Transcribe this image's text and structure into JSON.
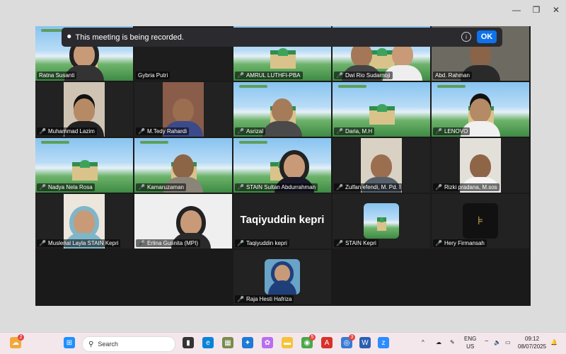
{
  "window_controls": {
    "minimize": "—",
    "restore": "❐",
    "close": "✕"
  },
  "banner": {
    "text": "This meeting is being recorded.",
    "ok_label": "OK",
    "info_symbol": "i"
  },
  "tiles": [
    "Ratna Susanti",
    "Gybria Putri",
    "AMRUL LUTHFI-PBA",
    "Dwi Rio Sudarnoji",
    "Abd. Rahman",
    "Muhammad Lazim",
    "M.Tedy Rahardi",
    "Asrizal",
    "Daria, M.H",
    "LENOVO",
    "Nadya Nela Rosa",
    "Kamaruzaman",
    "STAIN Sultan Abdurrahman",
    "Zulfan efendi, M. Pd. I",
    "Rizki pradana, M.sos",
    "Muslenal Layla STAIN Kepri",
    "Erlina Gusnita (MPI)",
    "Taqiyuddin kepri",
    "STAIN Kepri",
    "Hery Firmansah",
    "Raja Hesti Hafriza"
  ],
  "big_name": "Taqiyuddin kepri",
  "taskbar": {
    "search_placeholder": "Search",
    "weather_badge": "2",
    "chrome_badge": "5",
    "zoom_badge": "3",
    "lang_line1": "ENG",
    "lang_line2": "US",
    "time": "09:12",
    "date": "08/07/2025"
  }
}
